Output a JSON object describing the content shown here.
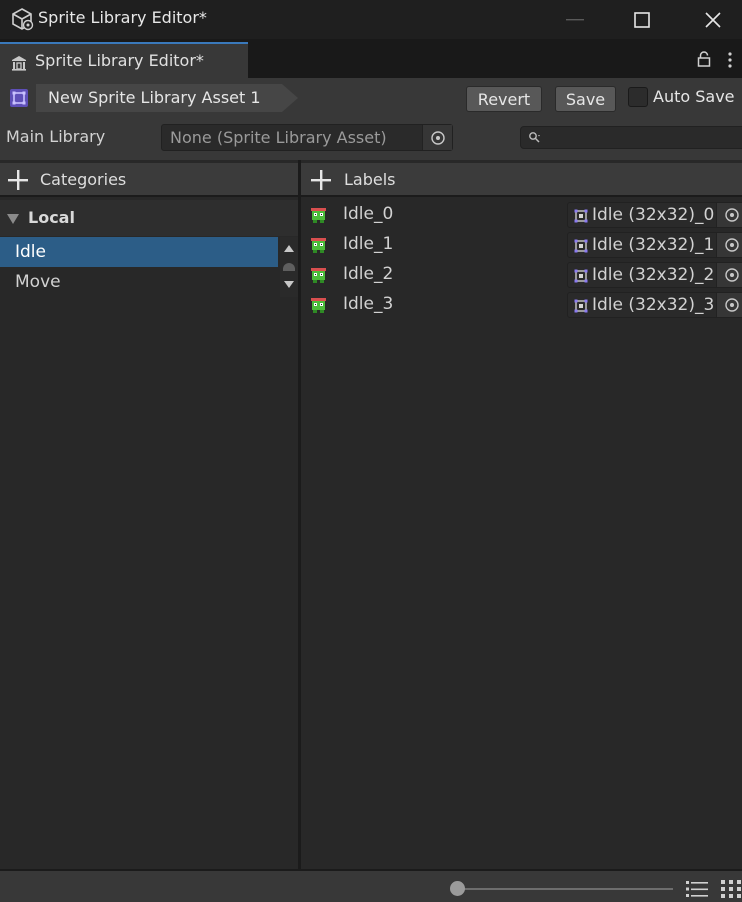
{
  "window": {
    "title": "Sprite Library Editor*",
    "icon": "unity-cube-icon"
  },
  "tab": {
    "label": "Sprite Library Editor*",
    "icon": "sprite-library-icon"
  },
  "toolbar": {
    "asset_name": "New Sprite Library Asset 1",
    "revert_label": "Revert",
    "save_label": "Save",
    "autosave_label": "Auto Save",
    "autosave_checked": false
  },
  "main_library": {
    "label": "Main Library",
    "value": "None (Sprite Library Asset)",
    "search_value": ""
  },
  "categories": {
    "header": "Categories",
    "group": "Local",
    "items": [
      {
        "label": "Idle",
        "selected": true
      },
      {
        "label": "Move",
        "selected": false
      }
    ]
  },
  "labels": {
    "header": "Labels",
    "items": [
      {
        "name": "Idle_0",
        "sprite": "Idle (32x32)_0"
      },
      {
        "name": "Idle_1",
        "sprite": "Idle (32x32)_1"
      },
      {
        "name": "Idle_2",
        "sprite": "Idle (32x32)_2"
      },
      {
        "name": "Idle_3",
        "sprite": "Idle (32x32)_3"
      }
    ]
  },
  "footer": {
    "zoom_slider_value": 0
  },
  "colors": {
    "selection": "#2c5d87",
    "tab_accent": "#3a79bb",
    "icon_purple": "#8c7cf0",
    "frog_green": "#4cbb3a"
  }
}
